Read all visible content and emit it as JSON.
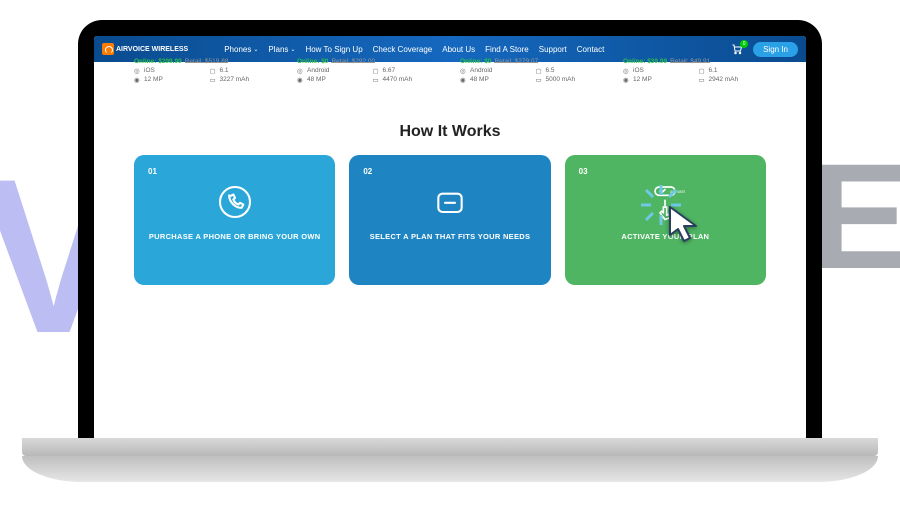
{
  "bg": {
    "left": "V",
    "right": "RE"
  },
  "nav": {
    "logo": "AIRVOICE WIRELESS",
    "items": [
      "Phones",
      "Plans",
      "How To Sign Up",
      "Check Coverage",
      "About Us",
      "Find A Store",
      "Support",
      "Contact"
    ],
    "signin": "Sign In",
    "cart_count": "0"
  },
  "phones": [
    {
      "online": "Online: $299.99",
      "retail": "Retail: $519.88",
      "os": "iOS",
      "screen": "6.1",
      "cam": "12 MP",
      "bat": "3227 mAh"
    },
    {
      "online": "Online: $0",
      "retail": "Retail: $292.00",
      "os": "Android",
      "screen": "6.67",
      "cam": "48 MP",
      "bat": "4470 mAh"
    },
    {
      "online": "Online: $0",
      "retail": "Retail: $279.07",
      "os": "Android",
      "screen": "6.5",
      "cam": "48 MP",
      "bat": "5000 mAh"
    },
    {
      "online": "Online: $39.99",
      "retail": "Retail: $49.91",
      "os": "iOS",
      "screen": "6.1",
      "cam": "12 MP",
      "bat": "2942 mAh"
    }
  ],
  "hiw": {
    "title": "How It Works",
    "cards": [
      {
        "num": "01",
        "text": "PURCHASE A PHONE OR BRING YOUR OWN"
      },
      {
        "num": "02",
        "text": "SELECT A PLAN THAT FITS YOUR NEEDS"
      },
      {
        "num": "03",
        "text": "ACTIVATE YOUR PLAN",
        "badge": "ACTIVATE"
      }
    ]
  }
}
